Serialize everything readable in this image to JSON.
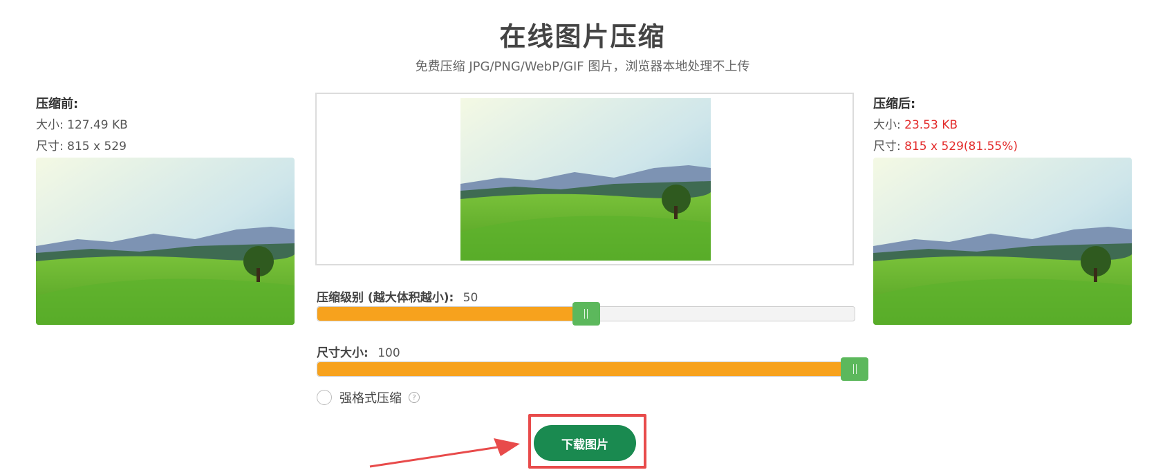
{
  "header": {
    "title": "在线图片压缩",
    "subtitle": "免费压缩 JPG/PNG/WebP/GIF 图片，浏览器本地处理不上传"
  },
  "before": {
    "heading": "压缩前:",
    "size_label": "大小:",
    "size_value": "127.49 KB",
    "dims_label": "尺寸:",
    "dims_value": "815 x 529"
  },
  "after": {
    "heading": "压缩后:",
    "size_label": "大小:",
    "size_value": "23.53 KB",
    "dims_label": "尺寸:",
    "dims_value": "815 x 529(81.55%)"
  },
  "compression": {
    "label": "压缩级别 (越大体积越小):",
    "value": "50",
    "level_fraction": 0.5
  },
  "resize": {
    "label": "尺寸大小:",
    "value": "100",
    "level_fraction": 1.0
  },
  "strict_mode": {
    "label": "强格式压缩",
    "help_icon": "?",
    "checked": false
  },
  "actions": {
    "download_label": "下载图片"
  },
  "colors": {
    "accent_orange": "#f7a21d",
    "handle_green": "#5cb85c",
    "button_green": "#1a8a50",
    "highlight_red": "#e84b4b",
    "value_red": "#e32a2a"
  },
  "icons": {
    "help": "question-circle-icon",
    "arrow": "arrow-right-icon"
  }
}
